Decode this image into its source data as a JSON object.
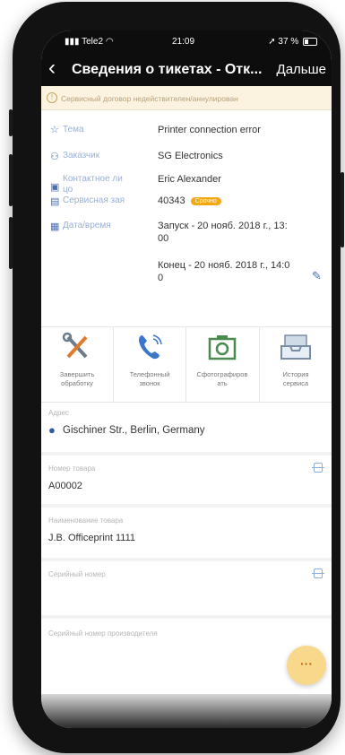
{
  "status_bar": {
    "carrier": "Tele2",
    "time": "21:09",
    "battery": "37 %"
  },
  "nav": {
    "back_icon": "‹",
    "title": "Сведения о тикетах - Отк...",
    "next_label": "Дальше"
  },
  "warning": {
    "icon": "!",
    "text": "Сервисный договор недействителен/аннулирован"
  },
  "details": {
    "subject": {
      "label": "Тема",
      "value": "Printer connection error"
    },
    "customer": {
      "label": "Заказчик",
      "value": "SG Electronics"
    },
    "contact": {
      "label_line1": "Контактное ли",
      "label_line2": "цо",
      "value": "Eric Alexander"
    },
    "service_order": {
      "label": "Сервисная зая",
      "value": "40343",
      "badge": "Срочно"
    },
    "datetime": {
      "label": "Дата/время",
      "start_line1": "Запуск - 20 нояб. 2018 г., 13:",
      "start_line2": "00",
      "end_line1": "Конец - 20 нояб. 2018 г., 14:0",
      "end_line2": "0"
    }
  },
  "actions": [
    {
      "line1": "Завершить",
      "line2": "обработку"
    },
    {
      "line1": "Телефонный",
      "line2": "звонок"
    },
    {
      "line1": "Сфотографиров",
      "line2": "ать"
    },
    {
      "line1": "История",
      "line2": "сервиса"
    }
  ],
  "address": {
    "label": "Адрес",
    "value": "Gischiner Str., Berlin, Germany"
  },
  "product_number": {
    "label": "Номер товара",
    "value": "A00002"
  },
  "product_name": {
    "label": "Наименование товара",
    "value": "J.B. Officeprint 1111"
  },
  "serial_number": {
    "label": "Серийный номер",
    "value": ""
  },
  "manufacturer_serial": {
    "label": "Серийный номер производителя"
  },
  "fab_label": "···",
  "colors": {
    "accent": "#4a6fb5",
    "warning_bg": "#fbf3e0",
    "badge": "#f2a713",
    "fab": "#f8d88a",
    "bar": "#0d0d0d"
  }
}
